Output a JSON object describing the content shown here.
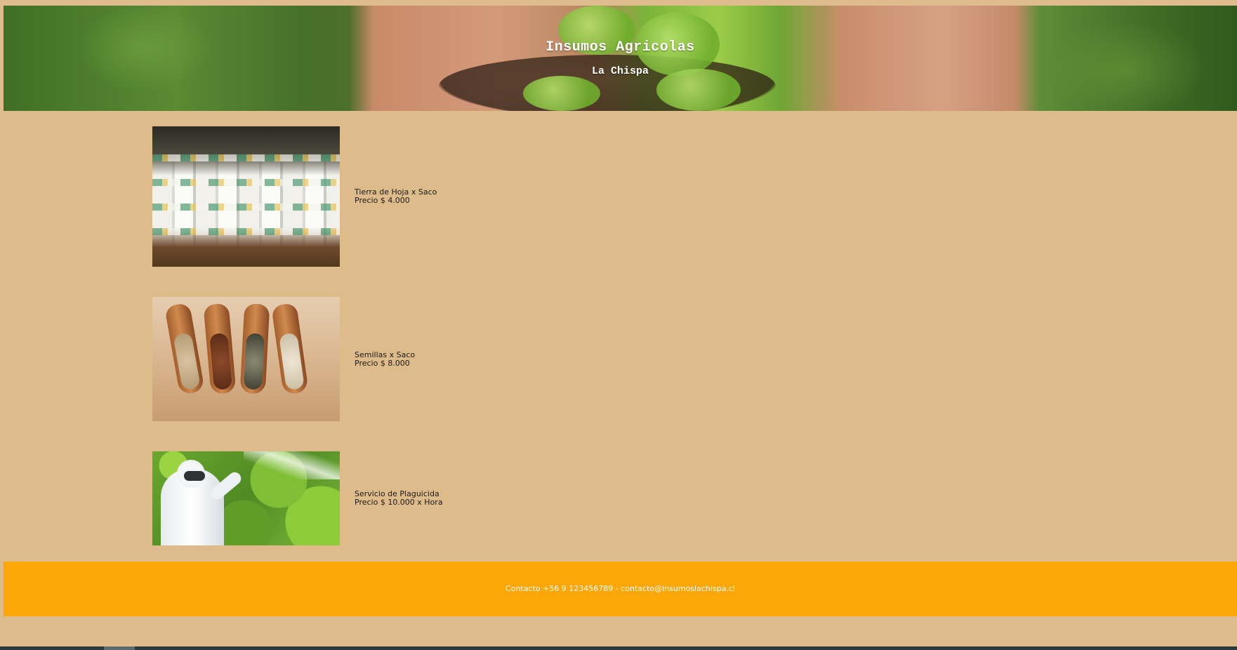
{
  "header": {
    "title": "Insumos Agricolas",
    "subtitle": "La Chispa"
  },
  "products": [
    {
      "name": "Tierra de Hoja x Saco",
      "price": "Precio $ 4.000",
      "image_icon": "soil-sacks-photo"
    },
    {
      "name": "Semillas x Saco",
      "price": "Precio $ 8.000",
      "image_icon": "seed-scoops-photo"
    },
    {
      "name": "Servicio de Plaguicida",
      "price": "Precio $ 10.000 x Hora",
      "image_icon": "pesticide-spraying-photo"
    }
  ],
  "footer": {
    "contact": "Contacto +56 9 123456789 - contacto@insumoslachispa.cl"
  },
  "colors": {
    "page_background": "#debb8a",
    "footer_background": "#fca607",
    "text": "#1a1a1a",
    "header_text": "#ffffff"
  }
}
